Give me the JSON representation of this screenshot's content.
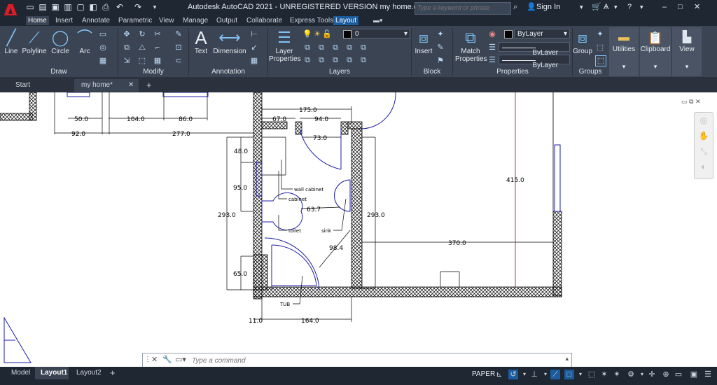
{
  "app": {
    "logo": "A",
    "title": "Autodesk AutoCAD 2021 - UNREGISTERED VERSION    my home.dwg"
  },
  "search": {
    "placeholder": "Type a keyword or phrase"
  },
  "user": {
    "sign_in": "Sign In"
  },
  "ribbon_tabs": [
    "Home",
    "Insert",
    "Annotate",
    "Parametric",
    "View",
    "Manage",
    "Output",
    "Collaborate",
    "Express Tools",
    "Layout"
  ],
  "draw_tools": [
    "Line",
    "Polyline",
    "Circle",
    "Arc"
  ],
  "annotation_tools": [
    "Text",
    "Dimension"
  ],
  "layer_properties": "Layer\nProperties",
  "layer_current": "0",
  "insert": "Insert",
  "match_properties": "Match\nProperties",
  "by_layer": [
    "ByLayer",
    "ByLayer",
    "ByLayer"
  ],
  "group": "Group",
  "utilities": "Utilities",
  "clipboard": "Clipboard",
  "view": "View",
  "panels": [
    "Draw",
    "Modify",
    "Annotation",
    "Layers",
    "Block",
    "Properties",
    "Groups"
  ],
  "doc_tabs": [
    "Start",
    "my home*"
  ],
  "layout_tabs": [
    "Model",
    "Layout1",
    "Layout2"
  ],
  "command": {
    "placeholder": "Type a command"
  },
  "status": {
    "paper": "PAPER"
  },
  "icons": [
    "autocad-logo",
    "new-icon",
    "open-icon",
    "save-icon",
    "saveas-icon",
    "plot-icon",
    "undo-icon",
    "redo-icon",
    "search-icon",
    "user-icon",
    "cart-icon",
    "help-icon"
  ],
  "drawing": {
    "dims": [
      "50.0",
      "104.0",
      "86.0",
      "92.0",
      "277.0",
      "175.0",
      "67.0",
      "94.0",
      "73.0",
      "48.0",
      "95.0",
      "293.0",
      "63.7",
      "293.0",
      "415.0",
      "370.0",
      "98.4",
      "65.0",
      "11.0",
      "164.0"
    ],
    "labels": [
      "wall cabinet",
      "cabinet",
      "toilet",
      "sink",
      "TUB"
    ]
  }
}
